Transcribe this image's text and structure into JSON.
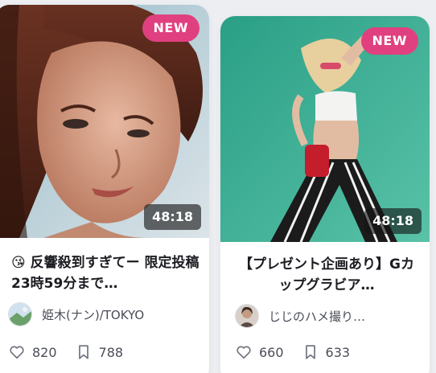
{
  "colors": {
    "new_badge": "#e0407f",
    "icon_stroke": "#6b6f7b"
  },
  "cards": [
    {
      "badge": "NEW",
      "duration": "48:18",
      "title": "😘 反響殺到すぎてー 限定投稿 23時59分まで…",
      "author": "姫木(ナン)/TOKYO",
      "likes": "820",
      "bookmarks": "788"
    },
    {
      "badge": "NEW",
      "duration": "48:18",
      "title": "【プレゼント企画あり】Gカップグラビア…",
      "author": "じじのハメ撮り…",
      "likes": "660",
      "bookmarks": "633"
    }
  ]
}
